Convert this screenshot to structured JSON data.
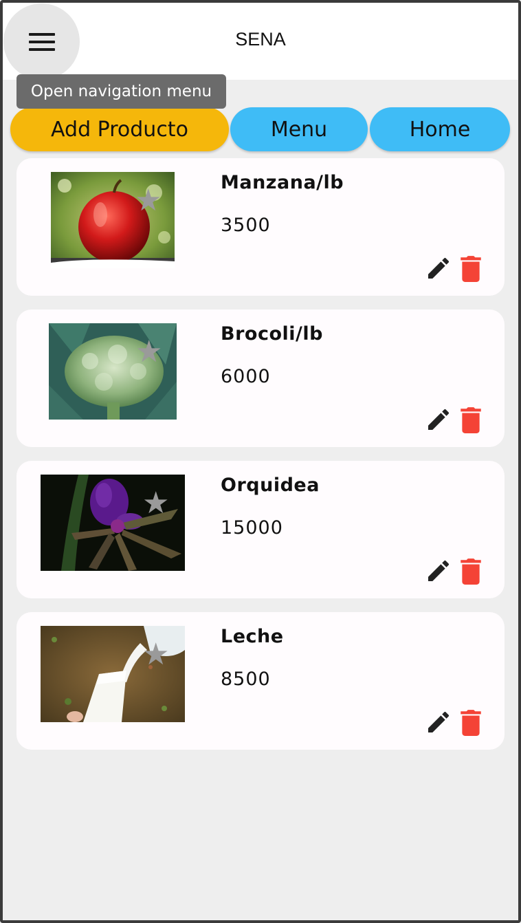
{
  "appbar": {
    "title": "SENA",
    "menu_icon": "hamburger-menu-icon",
    "tooltip": "Open navigation menu"
  },
  "actions": {
    "add_label": "Add Producto",
    "menu_label": "Menu",
    "home_label": "Home"
  },
  "colors": {
    "add_button": "#f5b70b",
    "nav_button": "#3fbcf6",
    "delete_icon": "#f44336",
    "edit_icon": "#222222",
    "star_icon": "#9a9a9a",
    "background": "#eeeeee"
  },
  "products": [
    {
      "name": "Manzana/lb",
      "price": "3500",
      "image": "apple-photo",
      "star_icon": "star-icon",
      "edit_icon": "pencil-icon",
      "delete_icon": "trash-icon"
    },
    {
      "name": "Brocoli/lb",
      "price": "6000",
      "image": "broccoli-photo",
      "star_icon": "star-icon",
      "edit_icon": "pencil-icon",
      "delete_icon": "trash-icon"
    },
    {
      "name": "Orquidea",
      "price": "15000",
      "image": "orchid-photo",
      "star_icon": "star-icon",
      "edit_icon": "pencil-icon",
      "delete_icon": "trash-icon"
    },
    {
      "name": "Leche",
      "price": "8500",
      "image": "milk-photo",
      "star_icon": "star-icon",
      "edit_icon": "pencil-icon",
      "delete_icon": "trash-icon"
    }
  ]
}
